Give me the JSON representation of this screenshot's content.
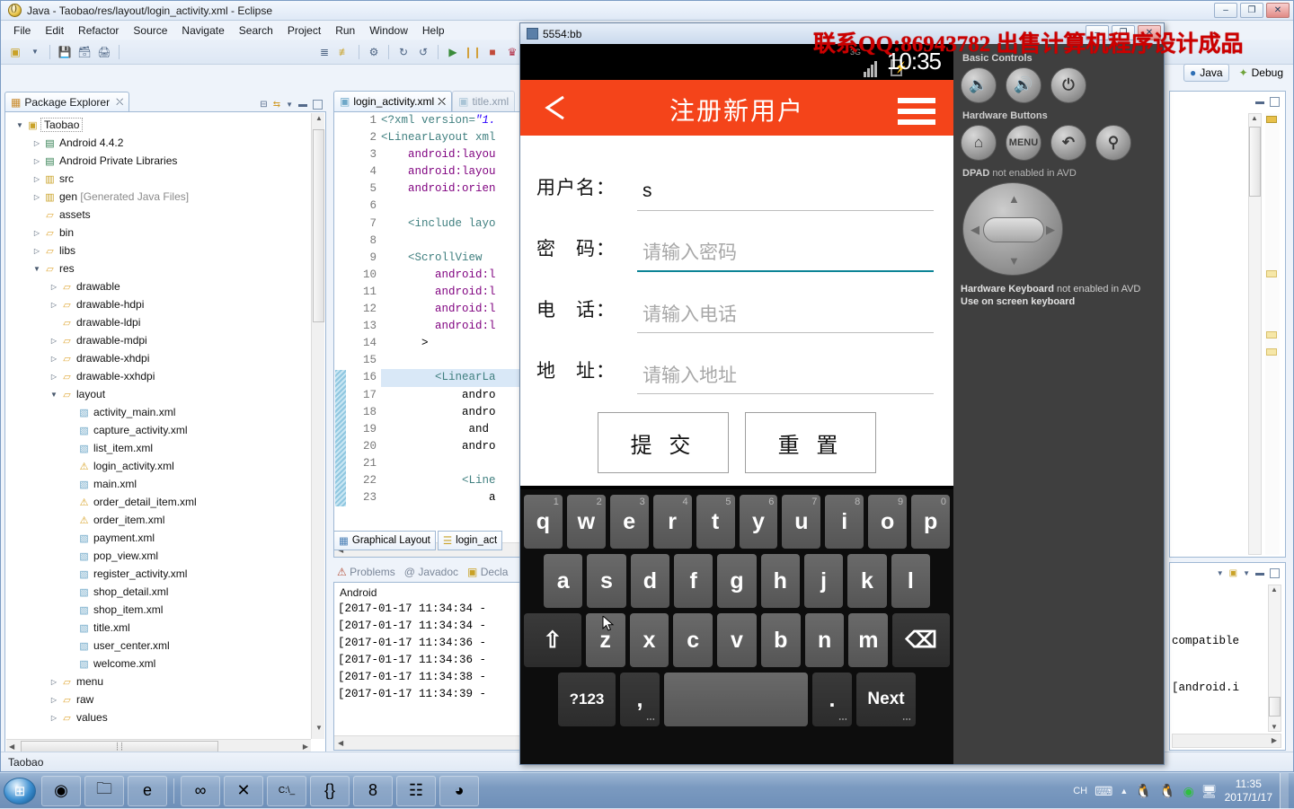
{
  "eclipse": {
    "window_title": "Java - Taobao/res/layout/login_activity.xml - Eclipse",
    "menu": [
      "File",
      "Edit",
      "Refactor",
      "Source",
      "Navigate",
      "Search",
      "Project",
      "Run",
      "Window",
      "Help"
    ],
    "window_buttons": {
      "minimize": "–",
      "maximize": "❐",
      "close": "✕"
    },
    "status_bar": "Taobao",
    "perspectives": [
      {
        "label": "Java",
        "active": true
      },
      {
        "label": "Debug",
        "active": false
      }
    ],
    "package_explorer": {
      "tab_label": "Package Explorer",
      "tree": [
        {
          "indent": 0,
          "arrow": "▼",
          "icon": "project-icon",
          "label": "Taobao",
          "selected": true
        },
        {
          "indent": 1,
          "arrow": "▷",
          "icon": "library-icon",
          "label": "Android 4.4.2"
        },
        {
          "indent": 1,
          "arrow": "▷",
          "icon": "library-icon",
          "label": "Android Private Libraries"
        },
        {
          "indent": 1,
          "arrow": "▷",
          "icon": "source-folder-icon",
          "label": "src"
        },
        {
          "indent": 1,
          "arrow": "▷",
          "icon": "source-folder-icon",
          "label": "gen",
          "dim": "[Generated Java Files]"
        },
        {
          "indent": 1,
          "arrow": "",
          "icon": "folder-icon",
          "label": "assets"
        },
        {
          "indent": 1,
          "arrow": "▷",
          "icon": "folder-icon",
          "label": "bin"
        },
        {
          "indent": 1,
          "arrow": "▷",
          "icon": "folder-icon",
          "label": "libs"
        },
        {
          "indent": 1,
          "arrow": "▼",
          "icon": "folder-icon",
          "label": "res"
        },
        {
          "indent": 2,
          "arrow": "▷",
          "icon": "folder-icon",
          "label": "drawable"
        },
        {
          "indent": 2,
          "arrow": "▷",
          "icon": "folder-icon",
          "label": "drawable-hdpi"
        },
        {
          "indent": 2,
          "arrow": "",
          "icon": "folder-icon",
          "label": "drawable-ldpi"
        },
        {
          "indent": 2,
          "arrow": "▷",
          "icon": "folder-icon",
          "label": "drawable-mdpi"
        },
        {
          "indent": 2,
          "arrow": "▷",
          "icon": "folder-icon",
          "label": "drawable-xhdpi"
        },
        {
          "indent": 2,
          "arrow": "▷",
          "icon": "folder-icon",
          "label": "drawable-xxhdpi"
        },
        {
          "indent": 2,
          "arrow": "▼",
          "icon": "folder-icon",
          "label": "layout"
        },
        {
          "indent": 3,
          "arrow": "",
          "icon": "xml-file-icon",
          "label": "activity_main.xml"
        },
        {
          "indent": 3,
          "arrow": "",
          "icon": "xml-file-icon",
          "label": "capture_activity.xml"
        },
        {
          "indent": 3,
          "arrow": "",
          "icon": "xml-file-icon",
          "label": "list_item.xml"
        },
        {
          "indent": 3,
          "arrow": "",
          "icon": "xml-warning-file-icon",
          "label": "login_activity.xml"
        },
        {
          "indent": 3,
          "arrow": "",
          "icon": "xml-file-icon",
          "label": "main.xml"
        },
        {
          "indent": 3,
          "arrow": "",
          "icon": "xml-warning-file-icon",
          "label": "order_detail_item.xml"
        },
        {
          "indent": 3,
          "arrow": "",
          "icon": "xml-warning-file-icon",
          "label": "order_item.xml"
        },
        {
          "indent": 3,
          "arrow": "",
          "icon": "xml-file-icon",
          "label": "payment.xml"
        },
        {
          "indent": 3,
          "arrow": "",
          "icon": "xml-file-icon",
          "label": "pop_view.xml"
        },
        {
          "indent": 3,
          "arrow": "",
          "icon": "xml-file-icon",
          "label": "register_activity.xml"
        },
        {
          "indent": 3,
          "arrow": "",
          "icon": "xml-file-icon",
          "label": "shop_detail.xml"
        },
        {
          "indent": 3,
          "arrow": "",
          "icon": "xml-file-icon",
          "label": "shop_item.xml"
        },
        {
          "indent": 3,
          "arrow": "",
          "icon": "xml-file-icon",
          "label": "title.xml"
        },
        {
          "indent": 3,
          "arrow": "",
          "icon": "xml-file-icon",
          "label": "user_center.xml"
        },
        {
          "indent": 3,
          "arrow": "",
          "icon": "xml-file-icon",
          "label": "welcome.xml"
        },
        {
          "indent": 2,
          "arrow": "▷",
          "icon": "folder-icon",
          "label": "menu"
        },
        {
          "indent": 2,
          "arrow": "▷",
          "icon": "folder-icon",
          "label": "raw"
        },
        {
          "indent": 2,
          "arrow": "▷",
          "icon": "folder-icon",
          "label": "values"
        }
      ]
    },
    "editor": {
      "tabs": [
        {
          "label": "login_activity.xml",
          "active": true
        },
        {
          "label": "title.xml",
          "active": false
        }
      ],
      "bottom_tabs": [
        {
          "label": "Graphical Layout",
          "active": true
        },
        {
          "label": "login_act",
          "active": false
        }
      ],
      "lines": [
        {
          "n": "1",
          "text": "<?xml version=\"1."
        },
        {
          "n": "2",
          "text": "<LinearLayout xml"
        },
        {
          "n": "3",
          "text": "    android:layou"
        },
        {
          "n": "4",
          "text": "    android:layou"
        },
        {
          "n": "5",
          "text": "    android:orien"
        },
        {
          "n": "6",
          "text": ""
        },
        {
          "n": "7",
          "text": "    <include layo"
        },
        {
          "n": "8",
          "text": ""
        },
        {
          "n": "9",
          "text": "    <ScrollView"
        },
        {
          "n": "10",
          "text": "        android:l"
        },
        {
          "n": "11",
          "text": "        android:l"
        },
        {
          "n": "12",
          "text": "        android:l"
        },
        {
          "n": "13",
          "text": "        android:l"
        },
        {
          "n": "14",
          "text": "      >"
        },
        {
          "n": "15",
          "text": ""
        },
        {
          "n": "16",
          "text": "        <LinearLa",
          "highlight": true
        },
        {
          "n": "17",
          "text": "            andro"
        },
        {
          "n": "18",
          "text": "            andro"
        },
        {
          "n": "19",
          "text": "             and"
        },
        {
          "n": "20",
          "text": "            andro"
        },
        {
          "n": "21",
          "text": ""
        },
        {
          "n": "22",
          "text": "            <Line"
        },
        {
          "n": "23",
          "text": "                a"
        }
      ]
    },
    "console": {
      "tabs": [
        "Problems",
        "Javadoc",
        "Decla"
      ],
      "header": "Android",
      "lines": [
        "[2017-01-17 11:34:34 -",
        "[2017-01-17 11:34:34 -",
        "[2017-01-17 11:34:36 -",
        "[2017-01-17 11:34:36 -",
        "[2017-01-17 11:34:38 -",
        "[2017-01-17 11:34:39 -"
      ]
    },
    "right_console": {
      "lines": [
        "compatible",
        "[android.i"
      ]
    }
  },
  "emulator": {
    "window_title": "5554:bb",
    "watermark": "联系QQ:86943782  出售计算机程序设计成品",
    "window_buttons": {
      "minimize": "–",
      "maximize": "❐",
      "close": "✕"
    },
    "android": {
      "status_bar": {
        "time": "10:35",
        "network": "3G"
      },
      "appbar": {
        "title": "注册新用户",
        "back": "back-arrow-icon",
        "menu": "hamburger-menu-icon"
      },
      "form": {
        "fields": [
          {
            "label": "用户名：",
            "value": "s",
            "placeholder": "",
            "focused": false
          },
          {
            "label": "密　码：",
            "value": "",
            "placeholder": "请输入密码",
            "focused": true
          },
          {
            "label": "电　话：",
            "value": "",
            "placeholder": "请输入电话",
            "focused": false
          },
          {
            "label": "地　址：",
            "value": "",
            "placeholder": "请输入地址",
            "focused": false
          }
        ],
        "buttons": [
          {
            "label": "提 交",
            "name": "submit-button"
          },
          {
            "label": "重 置",
            "name": "reset-button"
          }
        ]
      },
      "keyboard": {
        "row1": [
          {
            "k": "q",
            "n": "1"
          },
          {
            "k": "w",
            "n": "2"
          },
          {
            "k": "e",
            "n": "3"
          },
          {
            "k": "r",
            "n": "4"
          },
          {
            "k": "t",
            "n": "5"
          },
          {
            "k": "y",
            "n": "6"
          },
          {
            "k": "u",
            "n": "7"
          },
          {
            "k": "i",
            "n": "8"
          },
          {
            "k": "o",
            "n": "9"
          },
          {
            "k": "p",
            "n": "0"
          }
        ],
        "row2": [
          {
            "k": "a"
          },
          {
            "k": "s"
          },
          {
            "k": "d"
          },
          {
            "k": "f"
          },
          {
            "k": "g"
          },
          {
            "k": "h"
          },
          {
            "k": "j"
          },
          {
            "k": "k"
          },
          {
            "k": "l"
          }
        ],
        "row3": [
          {
            "k": "z"
          },
          {
            "k": "x"
          },
          {
            "k": "c"
          },
          {
            "k": "v"
          },
          {
            "k": "b"
          },
          {
            "k": "n"
          },
          {
            "k": "m"
          }
        ],
        "shift": "⇧",
        "backspace": "⌫",
        "symbols": "?123",
        "comma": ",",
        "space": "",
        "period": ".",
        "enter": "Next"
      }
    },
    "controls": {
      "basic_controls_label": "Basic Controls",
      "basic_buttons": [
        {
          "name": "volume-down-button",
          "glyph": "🔉"
        },
        {
          "name": "volume-up-button",
          "glyph": "🔊"
        },
        {
          "name": "power-button",
          "glyph": "⏻"
        }
      ],
      "hardware_buttons_label": "Hardware Buttons",
      "hardware_buttons": [
        {
          "name": "home-button",
          "glyph": "⌂"
        },
        {
          "name": "menu-button",
          "glyph": "MENU"
        },
        {
          "name": "back-button",
          "glyph": "↶"
        },
        {
          "name": "search-button",
          "glyph": "⚲"
        }
      ],
      "dpad_label_bold": "DPAD",
      "dpad_label_rest": "not enabled in AVD",
      "keyboard_note_bold": "Hardware Keyboard",
      "keyboard_note_rest": "not enabled in AVD",
      "keyboard_note_line2": "Use on screen keyboard"
    }
  },
  "taskbar": {
    "start": "⊞",
    "icons": [
      {
        "name": "chrome-taskbar-icon",
        "glyph": "◉"
      },
      {
        "name": "explorer-taskbar-icon",
        "glyph": "🗀"
      },
      {
        "name": "ie-taskbar-icon",
        "glyph": "e"
      },
      {
        "name": "visualstudio-taskbar-icon",
        "glyph": "∞"
      },
      {
        "name": "media-taskbar-icon",
        "glyph": "✕"
      },
      {
        "name": "cmd-taskbar-icon",
        "glyph": "C:\\_"
      },
      {
        "name": "json-taskbar-icon",
        "glyph": "{}"
      },
      {
        "name": "navicat-taskbar-icon",
        "glyph": "8"
      },
      {
        "name": "eclipse-window-taskbar-icon",
        "glyph": "☷"
      },
      {
        "name": "emulator-window-taskbar-icon",
        "glyph": "◕"
      }
    ],
    "tray": {
      "ime": "CH",
      "items": [
        {
          "name": "keyboard-tray-icon",
          "glyph": "⌨"
        },
        {
          "name": "show-hidden-icons",
          "glyph": "▲"
        },
        {
          "name": "qq-tray-icon-1",
          "glyph": "🐧"
        },
        {
          "name": "qq-tray-icon-2",
          "glyph": "🐧"
        },
        {
          "name": "wechat-tray-icon",
          "glyph": "◉"
        },
        {
          "name": "network-tray-icon",
          "glyph": "🖧"
        }
      ],
      "clock_time": "11:35",
      "clock_date": "2017/1/17"
    }
  }
}
